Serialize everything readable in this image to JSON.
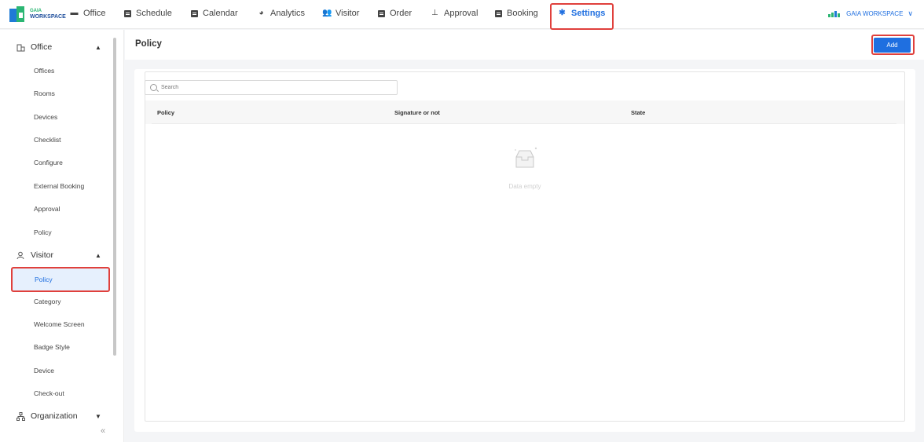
{
  "brand": {
    "line1": "GAIA",
    "line2": "WORKSPACE"
  },
  "nav": {
    "items": [
      {
        "label": "Office"
      },
      {
        "label": "Schedule"
      },
      {
        "label": "Calendar"
      },
      {
        "label": "Analytics"
      },
      {
        "label": "Visitor"
      },
      {
        "label": "Order"
      },
      {
        "label": "Approval"
      },
      {
        "label": "Booking"
      },
      {
        "label": "Settings"
      }
    ],
    "active": "Settings"
  },
  "workspace": {
    "name": "GAIA WORKSPACE"
  },
  "sidebar": {
    "office": {
      "label": "Office",
      "items": [
        "Offices",
        "Rooms",
        "Devices",
        "Checklist",
        "Configure",
        "External Booking",
        "Approval",
        "Policy"
      ]
    },
    "visitor": {
      "label": "Visitor",
      "active": "Policy",
      "items": [
        "Policy",
        "Category",
        "Welcome Screen",
        "Badge Style",
        "Device",
        "Check-out"
      ]
    },
    "organization": {
      "label": "Organization"
    },
    "collapse_glyph": "«"
  },
  "page": {
    "title": "Policy",
    "add_label": "Add",
    "search_placeholder": "Search",
    "columns": [
      "Policy",
      "Signature or not",
      "State"
    ],
    "empty_text": "Data empty"
  },
  "colors": {
    "primary": "#1f6fe0",
    "highlight": "#e0403c",
    "brand_green": "#2bb673"
  }
}
